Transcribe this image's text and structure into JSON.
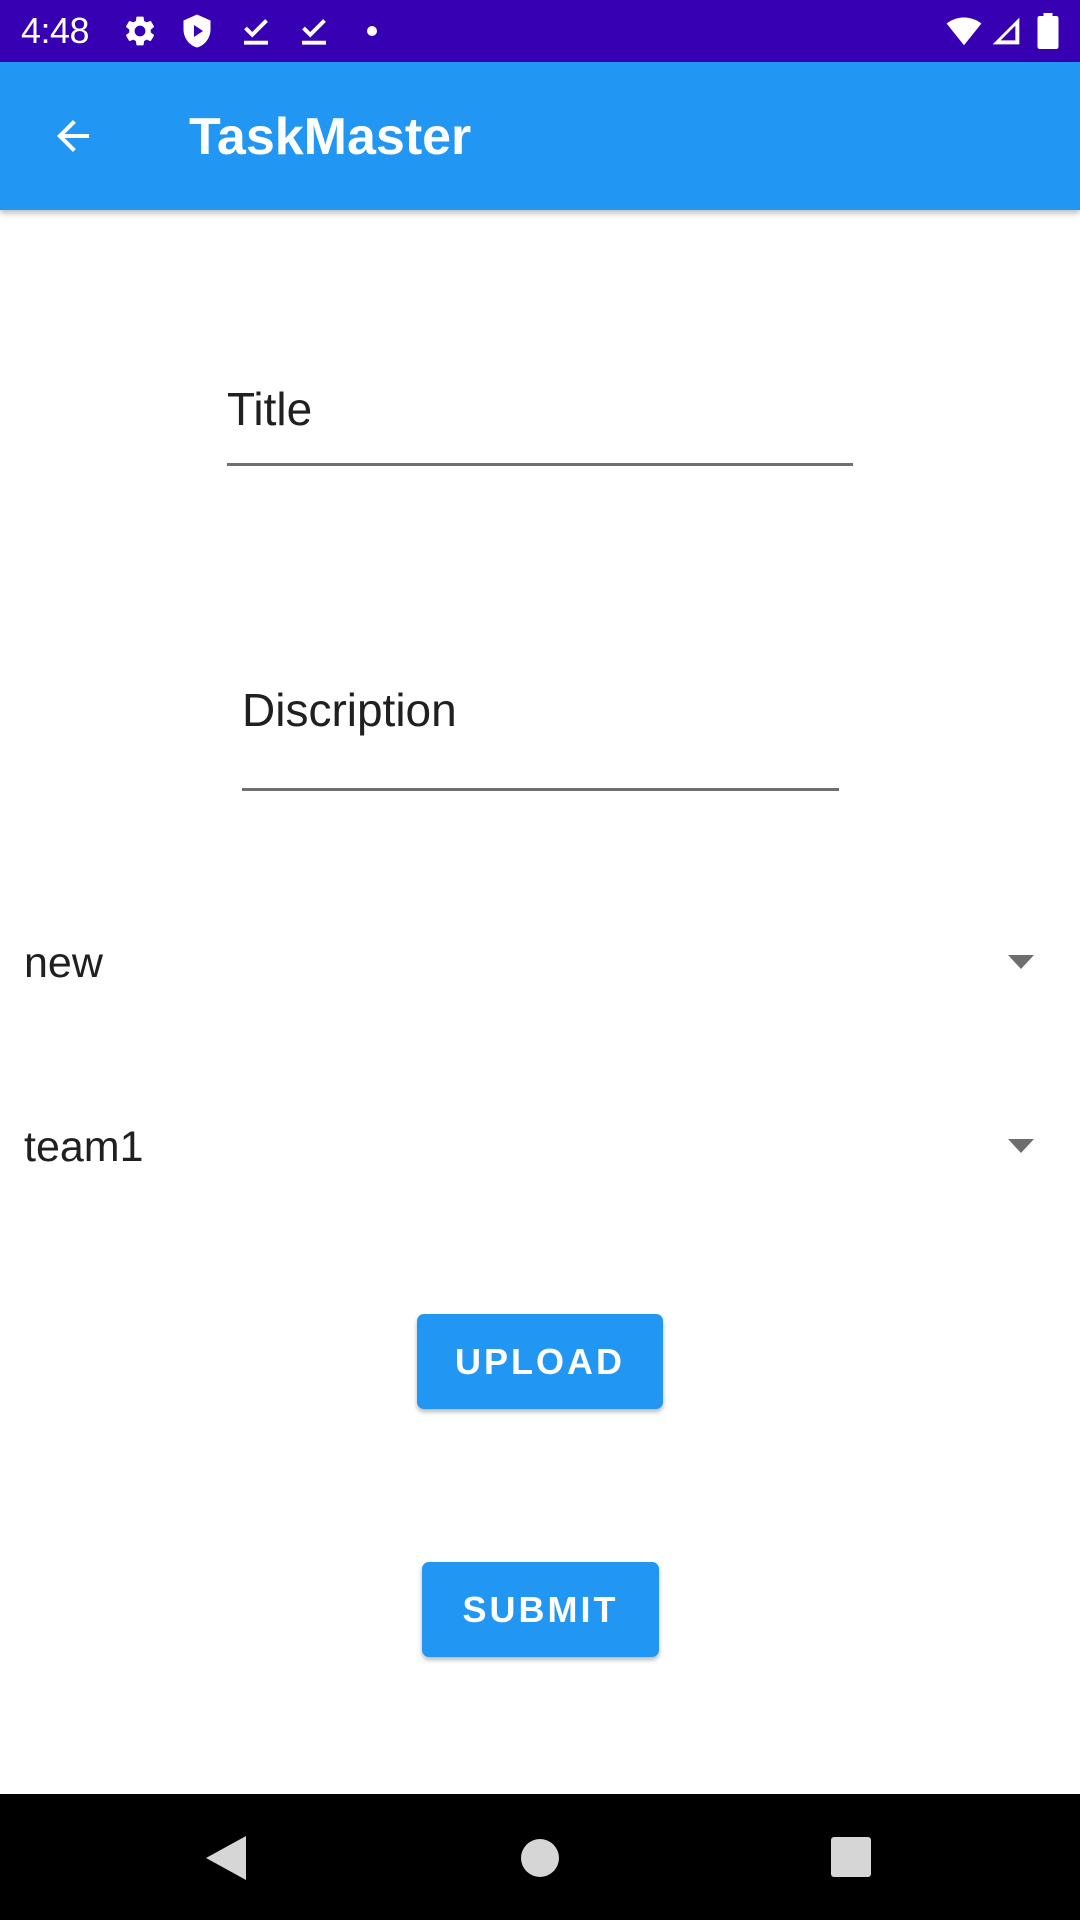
{
  "status_bar": {
    "time": "4:48",
    "icons": [
      "gear-icon",
      "shield-icon",
      "check-download-icon",
      "check-download-icon",
      "dot-icon",
      "wifi-icon",
      "signal-icon",
      "battery-icon"
    ]
  },
  "app_bar": {
    "title": "TaskMaster",
    "back_icon": "arrow-back-icon"
  },
  "form": {
    "title_field": {
      "placeholder": "Title",
      "value": ""
    },
    "description_field": {
      "placeholder": "Discription",
      "value": ""
    },
    "status_spinner": {
      "selected": "new"
    },
    "team_spinner": {
      "selected": "team1"
    },
    "upload_label": "UPLOAD",
    "submit_label": "SUBMIT"
  },
  "nav_bar": {
    "icons": [
      "back-triangle-icon",
      "home-circle-icon",
      "recents-square-icon"
    ]
  },
  "colors": {
    "status_bar": "#3700b3",
    "app_bar": "#2196f3",
    "button": "#2196f3",
    "field_underline": "#6f6f6f",
    "nav_bar": "#000000"
  }
}
